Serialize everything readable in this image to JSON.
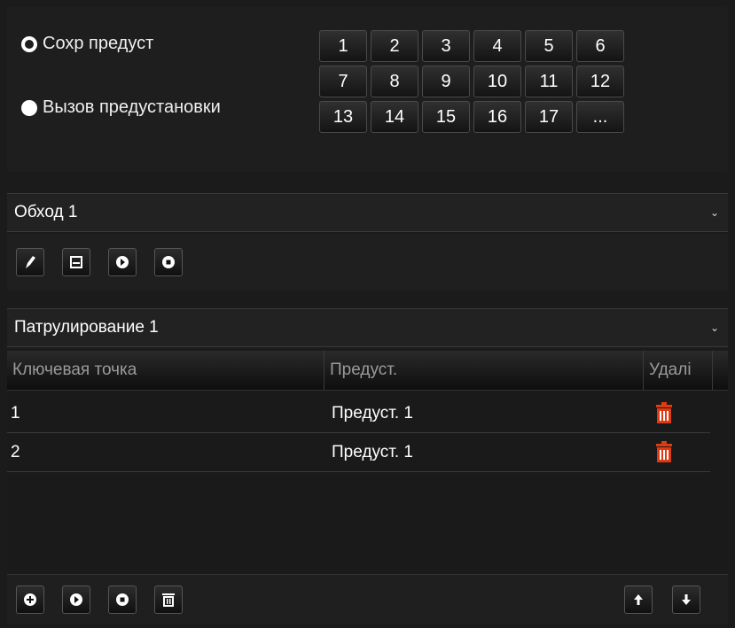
{
  "preset": {
    "save_label": "Сохр предуст",
    "call_label": "Вызов предустановки",
    "numbers": [
      "1",
      "2",
      "3",
      "4",
      "5",
      "6",
      "7",
      "8",
      "9",
      "10",
      "11",
      "12",
      "13",
      "14",
      "15",
      "16",
      "17",
      "..."
    ]
  },
  "tour": {
    "selected": "Обход 1",
    "toolbar_icons": [
      "pencil-icon",
      "save-icon",
      "play-icon",
      "stop-icon"
    ]
  },
  "patrol": {
    "selected": "Патрулирование 1",
    "columns": [
      "Ключевая точка",
      "Предуст.",
      "Удалі"
    ],
    "rows": [
      {
        "point": "1",
        "preset": "Предуст. 1"
      },
      {
        "point": "2",
        "preset": "Предуст. 1"
      }
    ],
    "bottom_icons": [
      "add-icon",
      "play-icon",
      "stop-icon",
      "clear-icon",
      "arrow-up-icon",
      "arrow-down-icon"
    ]
  },
  "colors": {
    "background": "#1b1b1b",
    "delete_icon": "#e03a12"
  }
}
